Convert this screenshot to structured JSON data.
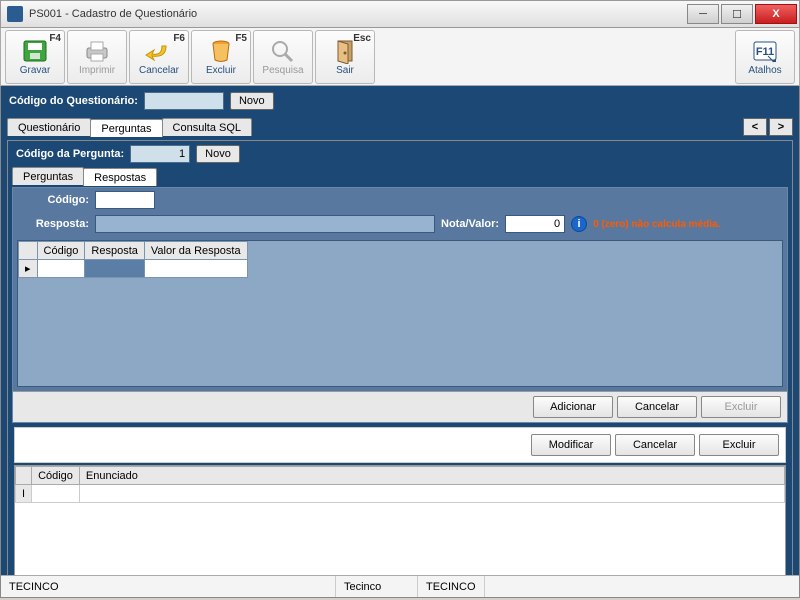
{
  "window": {
    "title": "PS001 - Cadastro de Questionário"
  },
  "toolbar": {
    "gravar": {
      "label": "Gravar",
      "key": "F4"
    },
    "imprimir": {
      "label": "Imprimir",
      "key": ""
    },
    "cancelar": {
      "label": "Cancelar",
      "key": "F6"
    },
    "excluir": {
      "label": "Excluir",
      "key": "F5"
    },
    "pesquisa": {
      "label": "Pesquisa",
      "key": ""
    },
    "sair": {
      "label": "Sair",
      "key": "Esc"
    },
    "atalhos": {
      "label": "Atalhos",
      "key": "F11"
    }
  },
  "questionario": {
    "codigo_label": "Código do Questionário:",
    "codigo_value": "",
    "novo_btn": "Novo"
  },
  "tabs": {
    "questionario": "Questionário",
    "perguntas": "Perguntas",
    "consulta": "Consulta SQL",
    "prev": "<",
    "next": ">"
  },
  "pergunta": {
    "codigo_label": "Código da Pergunta:",
    "codigo_value": "1",
    "novo_btn": "Novo"
  },
  "subtabs": {
    "perguntas": "Perguntas",
    "respostas": "Respostas"
  },
  "resposta_form": {
    "codigo_label": "Código:",
    "codigo_value": "",
    "resposta_label": "Resposta:",
    "resposta_value": "",
    "nota_label": "Nota/Valor:",
    "nota_value": "0",
    "warn": "0 (zero) não calcula média."
  },
  "resp_grid": {
    "cols": {
      "codigo": "Código",
      "resposta": "Resposta",
      "valor": "Valor da Resposta"
    }
  },
  "resp_buttons": {
    "adicionar": "Adicionar",
    "cancelar": "Cancelar",
    "excluir": "Excluir"
  },
  "outer_buttons": {
    "modificar": "Modificar",
    "cancelar": "Cancelar",
    "excluir": "Excluir"
  },
  "lower_grid": {
    "cols": {
      "codigo": "Código",
      "enunciado": "Enunciado"
    }
  },
  "status": {
    "left": "TECINCO",
    "mid": "Tecinco",
    "right": "TECINCO"
  }
}
